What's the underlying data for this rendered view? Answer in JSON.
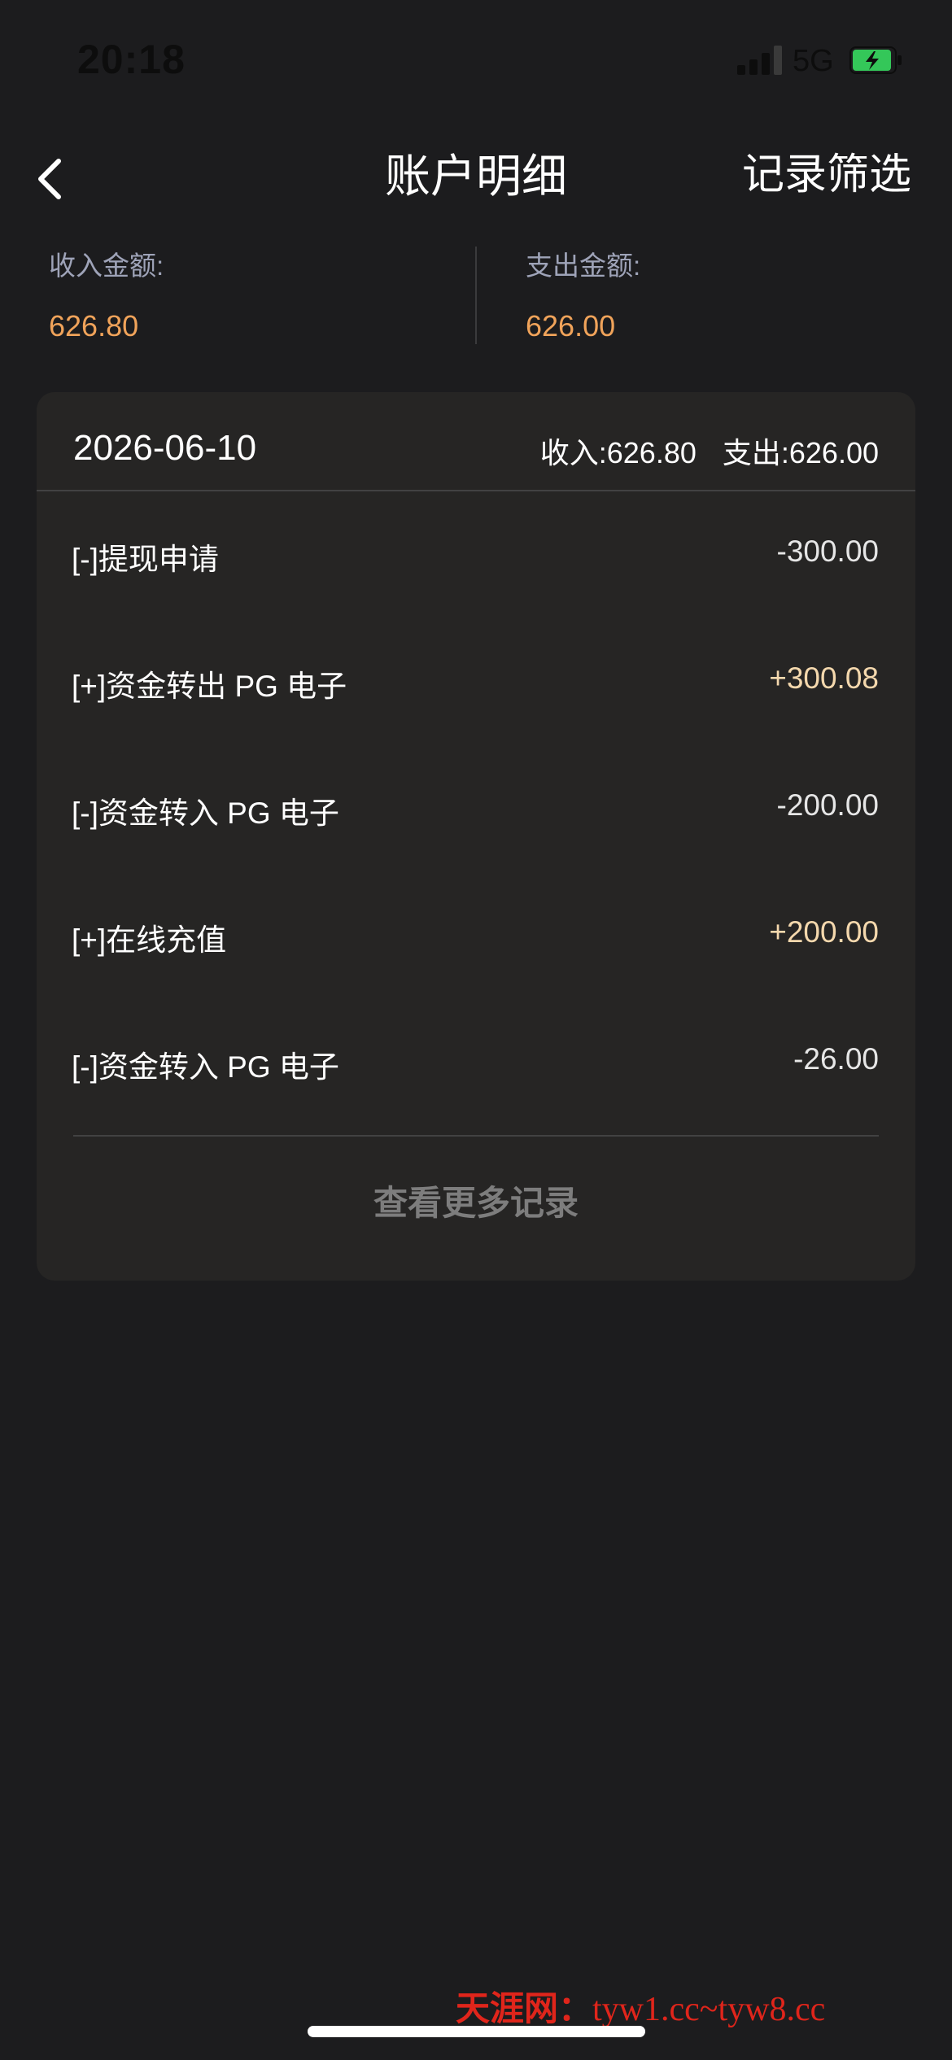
{
  "status_bar": {
    "time": "20:18",
    "network": "5G",
    "icons": [
      "signal-icon",
      "battery-charging-icon"
    ]
  },
  "nav": {
    "back_icon": "chevron-left-icon",
    "title": "账户明细",
    "filter_label": "记录筛选"
  },
  "summary": {
    "income_label": "收入金额:",
    "income_value": "626.80",
    "expense_label": "支出金额:",
    "expense_value": "626.00"
  },
  "day_group": {
    "date": "2026-06-10",
    "income": "收入:626.80",
    "expense": "支出:626.00",
    "records": [
      {
        "label": "[-]提现申请",
        "amount": "-300.00",
        "type": "out"
      },
      {
        "label": "[+]资金转出 PG 电子",
        "amount": "+300.08",
        "type": "in"
      },
      {
        "label": "[-]资金转入 PG 电子",
        "amount": "-200.00",
        "type": "out"
      },
      {
        "label": "[+]在线充值",
        "amount": "+200.00",
        "type": "in"
      },
      {
        "label": "[-]资金转入 PG 电子",
        "amount": "-26.00",
        "type": "out"
      }
    ],
    "more_label": "查看更多记录"
  },
  "watermark": {
    "cn": "天涯网：",
    "en": "tyw1.cc~tyw8.cc"
  },
  "colors": {
    "background": "#1c1c1e",
    "card": "#262524",
    "summary_value": "#f0a35a",
    "positive_amount": "#f4d8ad",
    "label_muted": "#9ea3b8"
  }
}
